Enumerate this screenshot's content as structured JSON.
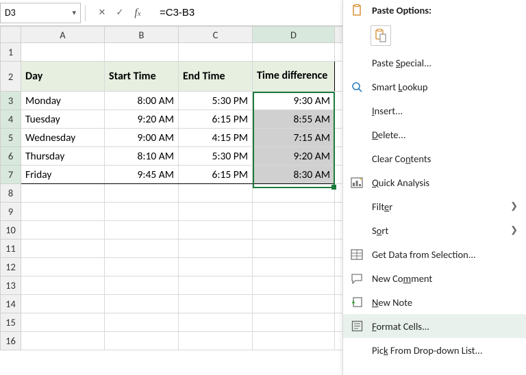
{
  "formula_bar": {
    "name_box": "D3",
    "formula": "=C3-B3"
  },
  "columns": [
    "A",
    "B",
    "C",
    "D"
  ],
  "headers": {
    "day": "Day",
    "start": "Start Time",
    "end": "End Time",
    "diff": "Time difference"
  },
  "rows": [
    {
      "day": "Monday",
      "start": "8:00 AM",
      "end": "5:30 PM",
      "diff": "9:30 AM"
    },
    {
      "day": "Tuesday",
      "start": "9:20 AM",
      "end": "6:15 PM",
      "diff": "8:55 AM"
    },
    {
      "day": "Wednesday",
      "start": "9:00 AM",
      "end": "4:15 PM",
      "diff": "7:15 AM"
    },
    {
      "day": "Thursday",
      "start": "8:10 AM",
      "end": "5:30 PM",
      "diff": "9:20 AM"
    },
    {
      "day": "Friday",
      "start": "9:45 AM",
      "end": "6:15 PM",
      "diff": "8:30 AM"
    }
  ],
  "menu": {
    "paste_options_title": "Paste Options:",
    "paste_special": "Paste Special...",
    "smart_lookup": "Smart Lookup",
    "insert": "Insert...",
    "delete": "Delete...",
    "clear_contents": "Clear Contents",
    "quick_analysis": "Quick Analysis",
    "filter": "Filter",
    "sort": "Sort",
    "get_data": "Get Data from Selection...",
    "new_comment": "New Comment",
    "new_note": "New Note",
    "format_cells": "Format Cells...",
    "pick_list": "Pick From Drop-down List..."
  }
}
